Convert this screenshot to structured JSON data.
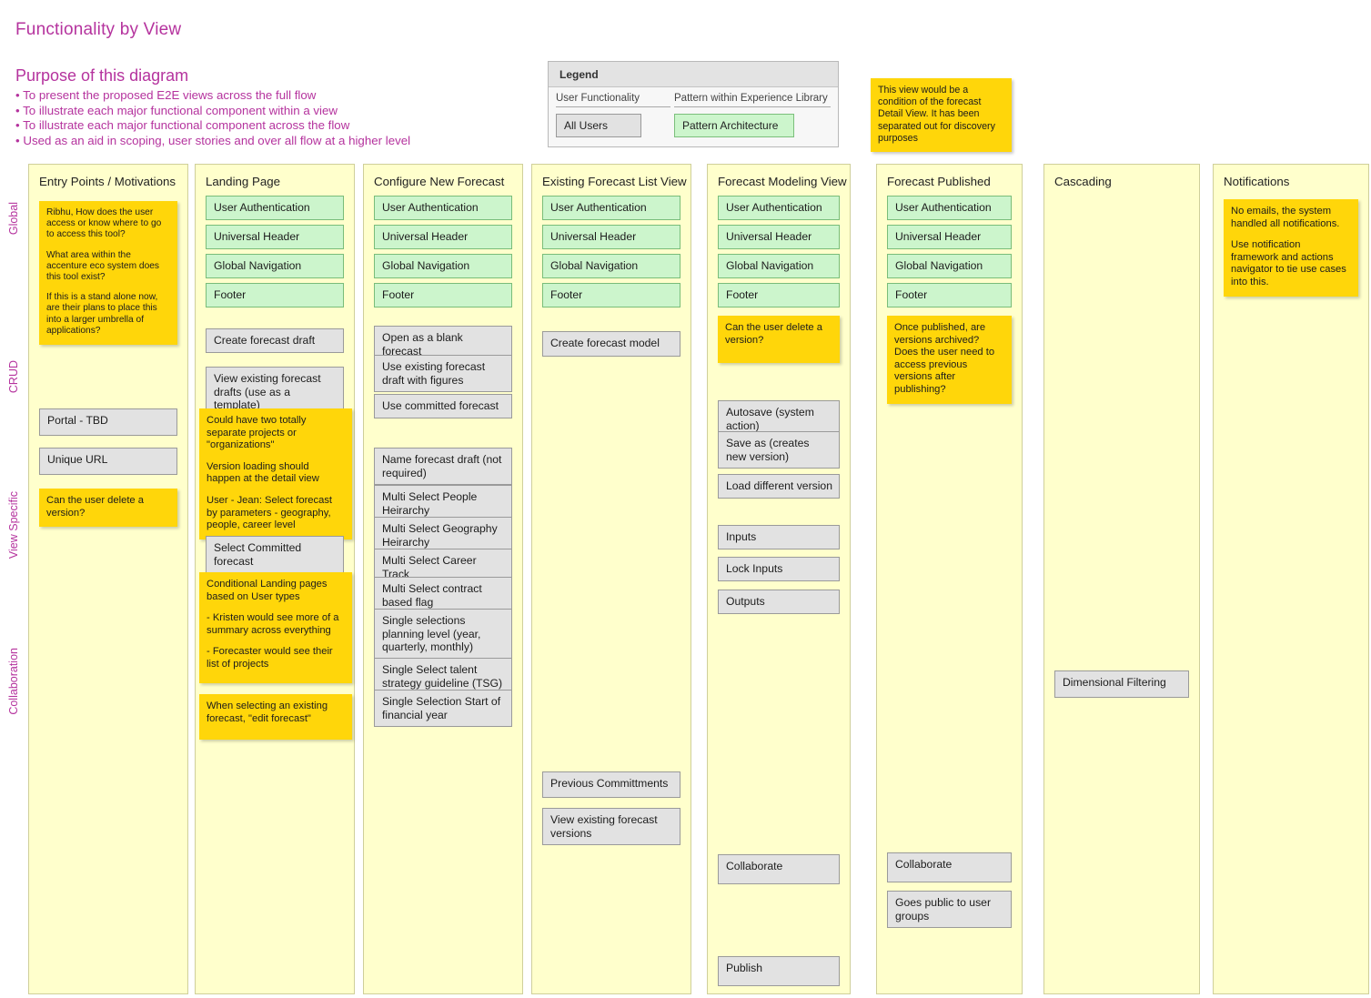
{
  "header": {
    "title": "Functionality by View",
    "purpose_heading": "Purpose of this diagram",
    "purpose_bullets": [
      "• To present the proposed E2E views across the full flow",
      "• To illustrate each major functional component within a view",
      "• To illustrate each major functional component across the flow",
      "• Used as an aid in scoping, user stories and over all flow at a higher level"
    ]
  },
  "legend": {
    "title": "Legend",
    "col_a_header": "User Functionality",
    "col_a_chip": "All Users",
    "col_b_header": "Pattern within Experience Library",
    "col_b_chip": "Pattern Architecture"
  },
  "top_note": "This view would be a condition of the forecast Detail View.  It has been separated out for discovery purposes",
  "row_labels": [
    "Global",
    "CRUD",
    "View Specific",
    "Collaboration"
  ],
  "colors": {
    "accent_magenta": "#b5339e",
    "column_background": "#ffffcc",
    "pattern_green": "#ccf5cc",
    "functionality_gray": "#e2e2e2",
    "note_yellow": "#ffd60a"
  },
  "columns": [
    {
      "title": "Entry Points / Motivations",
      "items": [
        {
          "kind": "note",
          "lines": [
            "Ribhu,\nHow does the user access or know where to go to access this tool?",
            "What area within the accenture eco system does this tool exist?",
            "If this is a stand alone now, are their plans to place this into a larger umbrella of applications?"
          ]
        },
        {
          "kind": "gray",
          "label": "Portal - TBD"
        },
        {
          "kind": "gray",
          "label": "Unique URL"
        },
        {
          "kind": "note",
          "lines": [
            "Can the user delete a version?"
          ]
        }
      ]
    },
    {
      "title": "Landing Page",
      "items": [
        {
          "kind": "green",
          "label": "User Authentication"
        },
        {
          "kind": "green",
          "label": "Universal Header"
        },
        {
          "kind": "green",
          "label": "Global Navigation"
        },
        {
          "kind": "green",
          "label": "Footer"
        },
        {
          "kind": "gray",
          "label": "Create forecast draft"
        },
        {
          "kind": "gray",
          "label": "View existing forecast drafts (use as a template)"
        },
        {
          "kind": "note",
          "lines": [
            "Could have two totally separate projects or \"organizations\"",
            "Version loading should happen at the detail view",
            "User - Jean: Select forecast by parameters - geography, people, career level"
          ]
        },
        {
          "kind": "gray",
          "label": "Select Committed forecast"
        },
        {
          "kind": "note",
          "lines": [
            "Conditional Landing pages based on User types",
            "- Kristen would see more of a summary across everything",
            "- Forecaster would see their list of projects"
          ]
        },
        {
          "kind": "note",
          "lines": [
            "When selecting an existing forecast, \"edit forecast\""
          ]
        }
      ]
    },
    {
      "title": "Configure New Forecast",
      "items": [
        {
          "kind": "green",
          "label": "User Authentication"
        },
        {
          "kind": "green",
          "label": "Universal Header"
        },
        {
          "kind": "green",
          "label": "Global Navigation"
        },
        {
          "kind": "green",
          "label": "Footer"
        },
        {
          "kind": "gray",
          "label": "Open as a blank forecast"
        },
        {
          "kind": "gray",
          "label": "Use existing forecast draft with figures"
        },
        {
          "kind": "gray",
          "label": "Use committed forecast"
        },
        {
          "kind": "gray",
          "label": "Name forecast draft (not required)"
        },
        {
          "kind": "gray",
          "label": "Multi Select People Heirarchy"
        },
        {
          "kind": "gray",
          "label": "Multi Select Geography Heirarchy"
        },
        {
          "kind": "gray",
          "label": "Multi Select Career Track"
        },
        {
          "kind": "gray",
          "label": "Multi Select contract based flag"
        },
        {
          "kind": "gray",
          "label": "Single selections planning level (year, quarterly, monthly)"
        },
        {
          "kind": "gray",
          "label": "Single Select talent strategy guideline (TSG)"
        },
        {
          "kind": "gray",
          "label": "Single Selection Start of financial year"
        }
      ]
    },
    {
      "title": "Existing Forecast List View",
      "items": [
        {
          "kind": "green",
          "label": "User Authentication"
        },
        {
          "kind": "green",
          "label": "Universal Header"
        },
        {
          "kind": "green",
          "label": "Global Navigation"
        },
        {
          "kind": "green",
          "label": "Footer"
        },
        {
          "kind": "gray",
          "label": "Create forecast model"
        },
        {
          "kind": "gray",
          "label": "Previous Committments"
        },
        {
          "kind": "gray",
          "label": "View existing forecast versions"
        }
      ]
    },
    {
      "title": "Forecast Modeling View",
      "items": [
        {
          "kind": "green",
          "label": "User Authentication"
        },
        {
          "kind": "green",
          "label": "Universal Header"
        },
        {
          "kind": "green",
          "label": "Global Navigation"
        },
        {
          "kind": "green",
          "label": "Footer"
        },
        {
          "kind": "note",
          "lines": [
            "Can the user delete a version?"
          ]
        },
        {
          "kind": "gray",
          "label": "Autosave (system action)"
        },
        {
          "kind": "gray",
          "label": "Save as (creates new version)"
        },
        {
          "kind": "gray",
          "label": "Load different version"
        },
        {
          "kind": "gray",
          "label": "Inputs"
        },
        {
          "kind": "gray",
          "label": "Lock Inputs"
        },
        {
          "kind": "gray",
          "label": "Outputs"
        },
        {
          "kind": "gray",
          "label": "Collaborate"
        },
        {
          "kind": "gray",
          "label": "Publish"
        }
      ]
    },
    {
      "title": "Forecast Published",
      "items": [
        {
          "kind": "green",
          "label": "User Authentication"
        },
        {
          "kind": "green",
          "label": "Universal Header"
        },
        {
          "kind": "green",
          "label": "Global Navigation"
        },
        {
          "kind": "green",
          "label": "Footer"
        },
        {
          "kind": "note",
          "lines": [
            "Once published, are versions archived? Does the user need to access previous versions after publishing?"
          ]
        },
        {
          "kind": "gray",
          "label": "Collaborate"
        },
        {
          "kind": "gray",
          "label": "Goes public to user groups"
        }
      ]
    },
    {
      "title": "Cascading",
      "items": [
        {
          "kind": "gray",
          "label": "Dimensional Filtering"
        }
      ]
    },
    {
      "title": "Notifications",
      "items": [
        {
          "kind": "note",
          "lines": [
            "No emails, the system handled all notifications.",
            "Use notification framework and actions navigator to tie use cases into this."
          ]
        }
      ]
    }
  ]
}
